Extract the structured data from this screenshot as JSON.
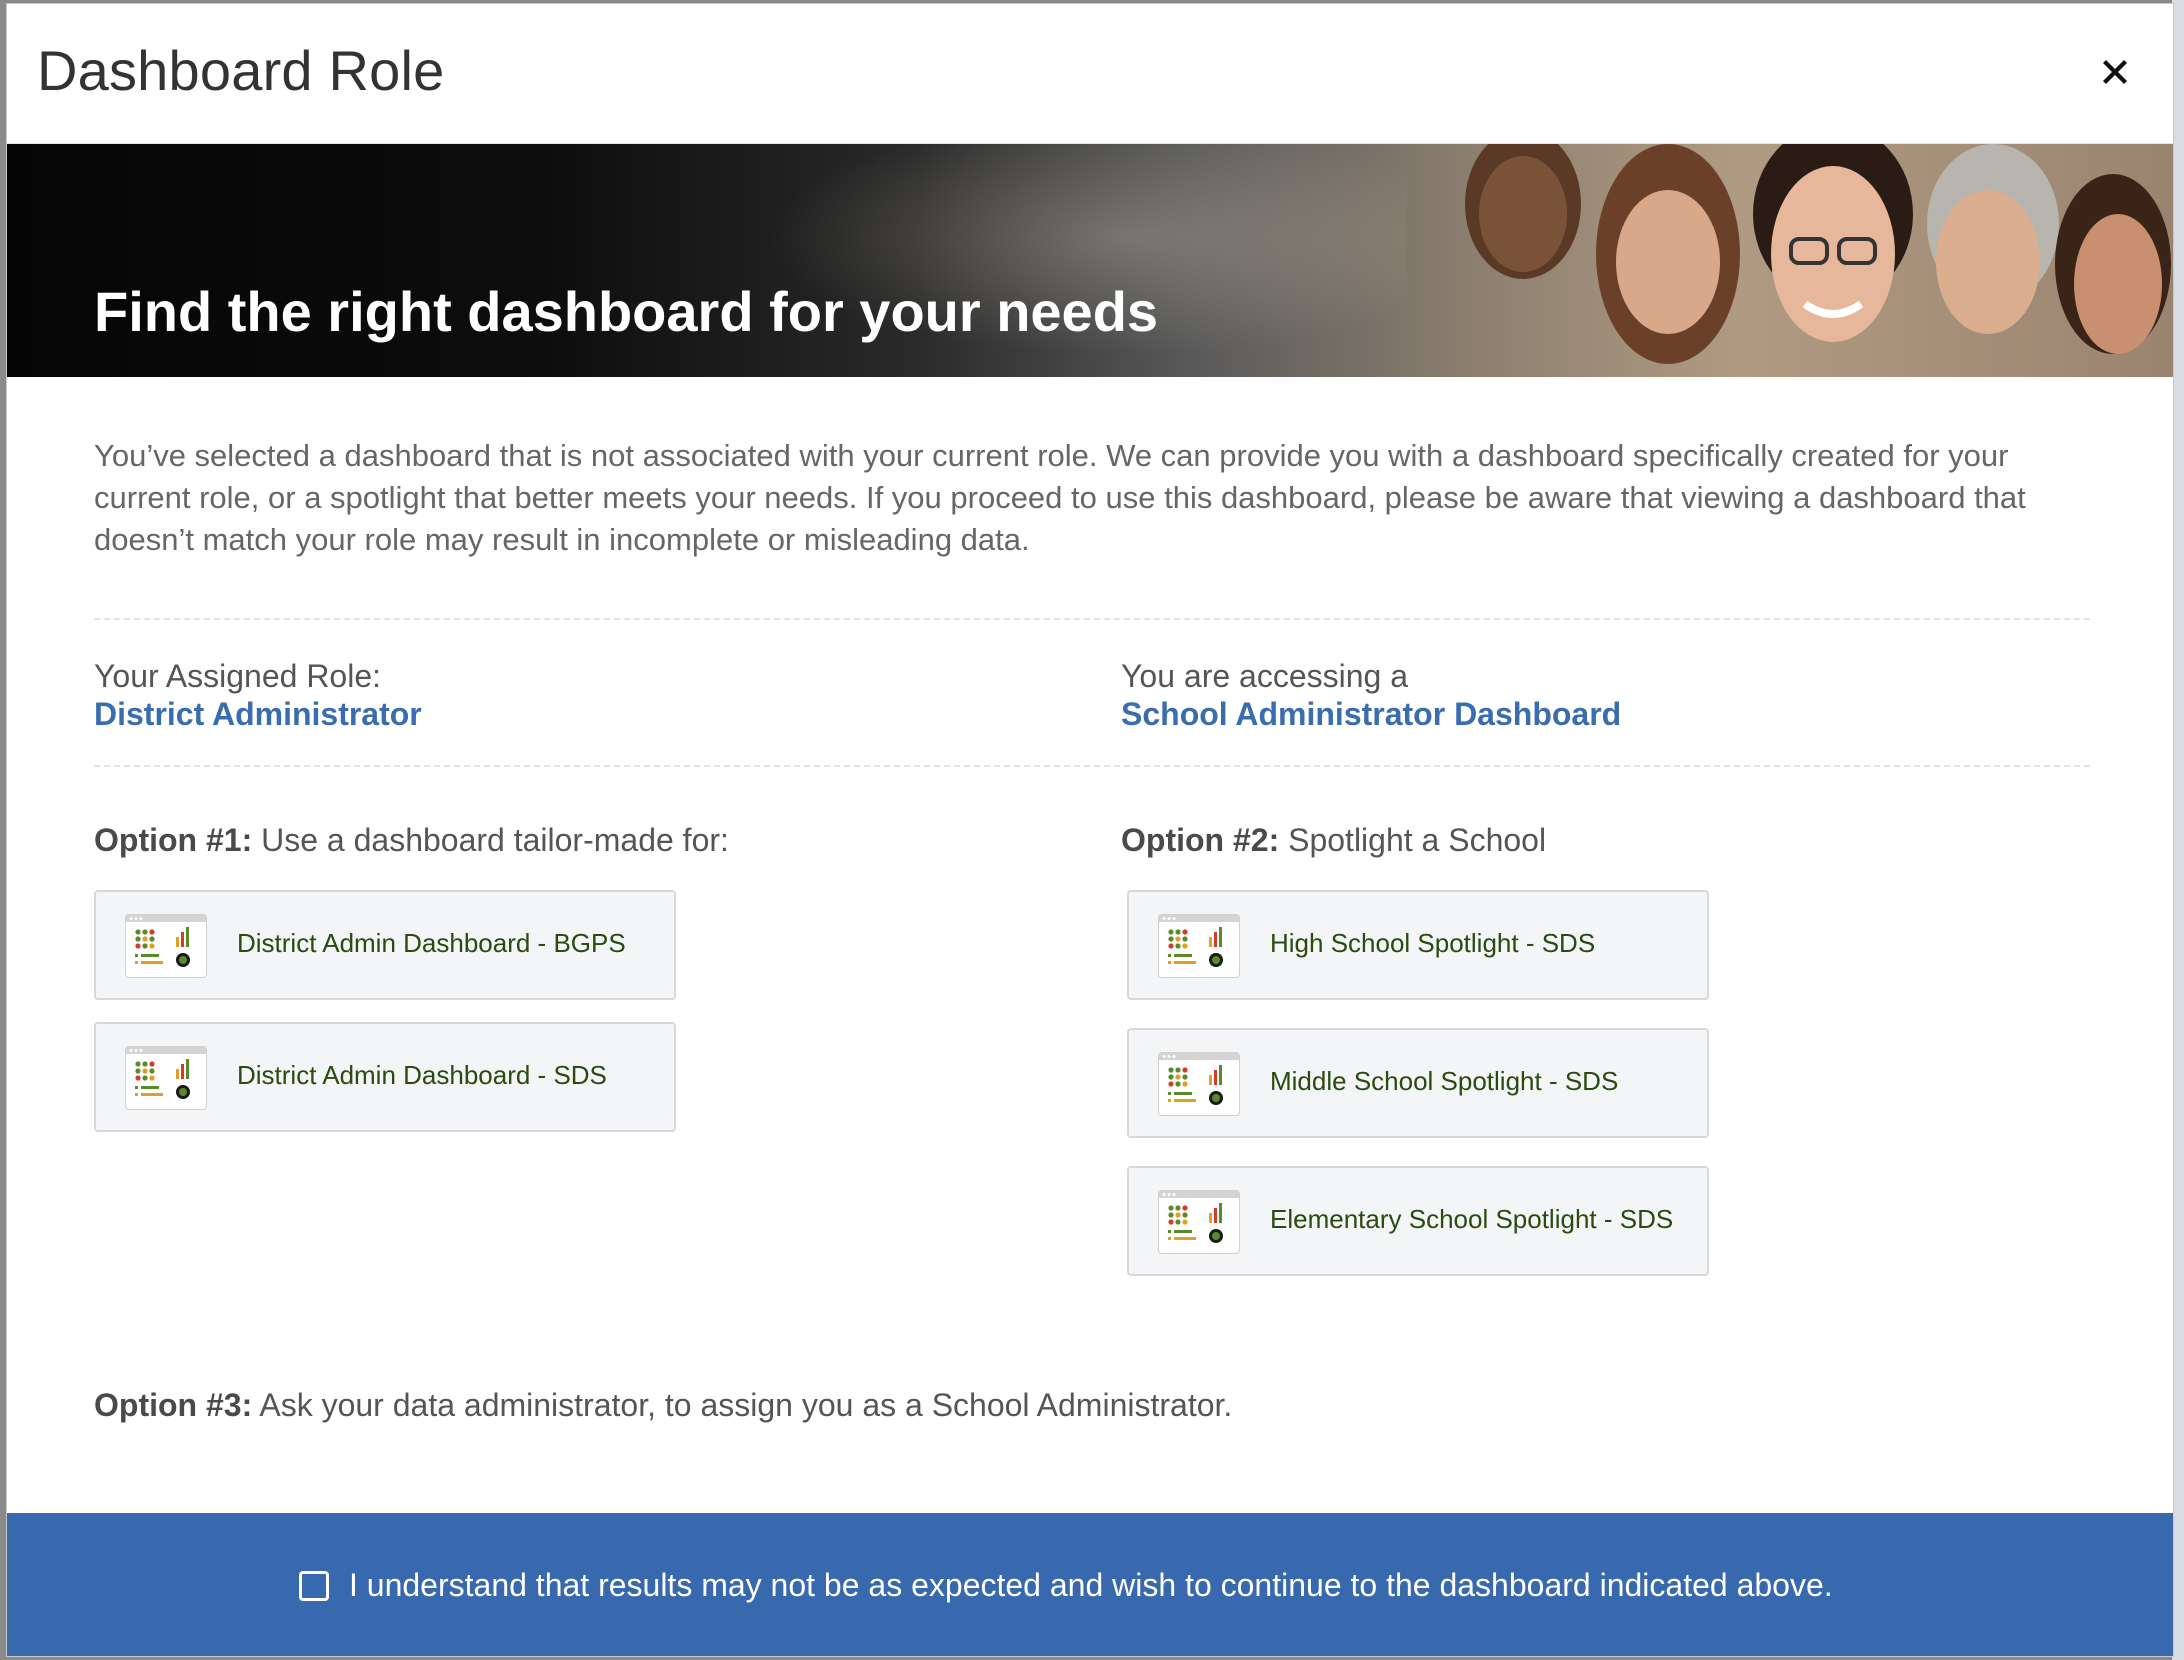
{
  "modal": {
    "title": "Dashboard Role",
    "close_icon": "close-icon"
  },
  "hero": {
    "heading": "Find the right dashboard for your needs"
  },
  "intro": "You’ve selected a dashboard that is not associated with your current role. We can provide you with a dashboard specifically created for your current role, or a spotlight that better meets your needs. If you proceed to use this dashboard, please be aware that viewing a dashboard that doesn’t match your role may result in incomplete or misleading data.",
  "assigned": {
    "label": "Your Assigned Role:",
    "value": "District Administrator"
  },
  "accessing": {
    "label": "You are accessing a",
    "value": "School Administrator Dashboard"
  },
  "option1": {
    "prefix": "Option #1:",
    "text": " Use a dashboard tailor-made for:",
    "items": [
      {
        "label": "District Admin Dashboard - BGPS",
        "icon": "dashboard-thumbnail-icon"
      },
      {
        "label": "District Admin Dashboard - SDS",
        "icon": "dashboard-thumbnail-icon"
      }
    ]
  },
  "option2": {
    "prefix": "Option #2:",
    "text": " Spotlight a School",
    "items": [
      {
        "label": "High School Spotlight - SDS",
        "icon": "dashboard-thumbnail-icon"
      },
      {
        "label": "Middle School Spotlight - SDS",
        "icon": "dashboard-thumbnail-icon"
      },
      {
        "label": "Elementary School Spotlight - SDS",
        "icon": "dashboard-thumbnail-icon"
      }
    ]
  },
  "option3": {
    "prefix": "Option #3:",
    "text": " Ask your data administrator, to assign you as a School Administrator."
  },
  "footer": {
    "ack_text": "I understand that results may not be as expected and wish to continue to the dashboard indicated above.",
    "ack_checked": false
  },
  "colors": {
    "link": "#3a6db0",
    "footer": "#3868ae",
    "card_text": "#2a4a10"
  }
}
